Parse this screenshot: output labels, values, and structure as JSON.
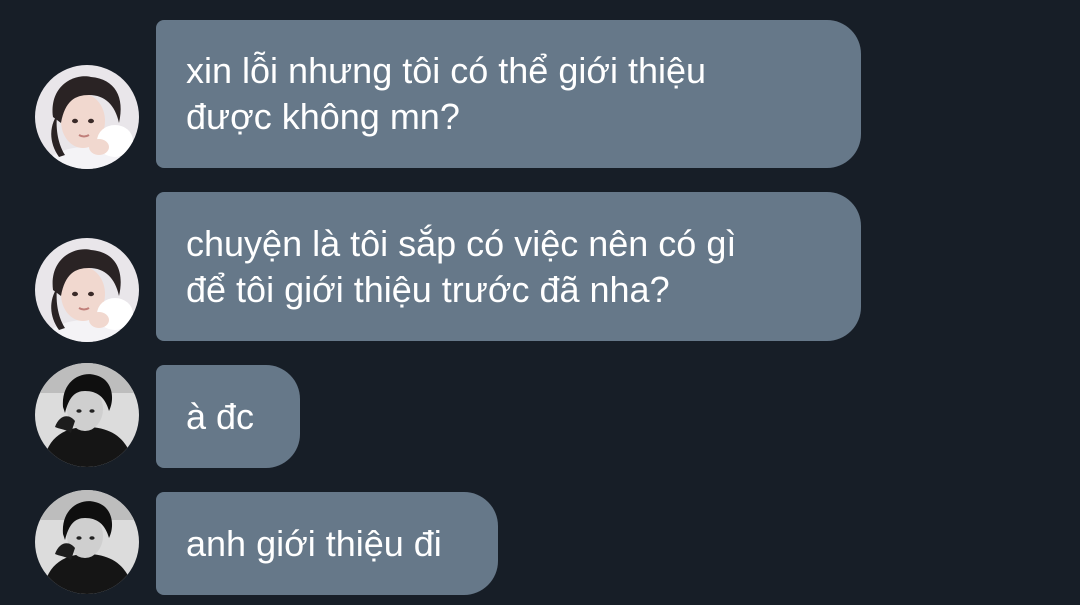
{
  "messages": [
    {
      "sender": "user-a",
      "lines": [
        "xin lỗi nhưng tôi có thể giới thiệu",
        "được không mn?"
      ]
    },
    {
      "sender": "user-a",
      "lines": [
        "chuyện là tôi sắp có việc nên có gì",
        "để tôi giới thiệu trước đã nha?"
      ]
    },
    {
      "sender": "user-b",
      "lines": [
        "à đc"
      ]
    },
    {
      "sender": "user-b",
      "lines": [
        "anh giới thiệu đi"
      ]
    }
  ],
  "colors": {
    "background": "#171e27",
    "bubble": "#667889",
    "text": "#ffffff"
  },
  "icons": {
    "user_a_avatar": "avatar-photo-light",
    "user_b_avatar": "avatar-photo-dark"
  }
}
